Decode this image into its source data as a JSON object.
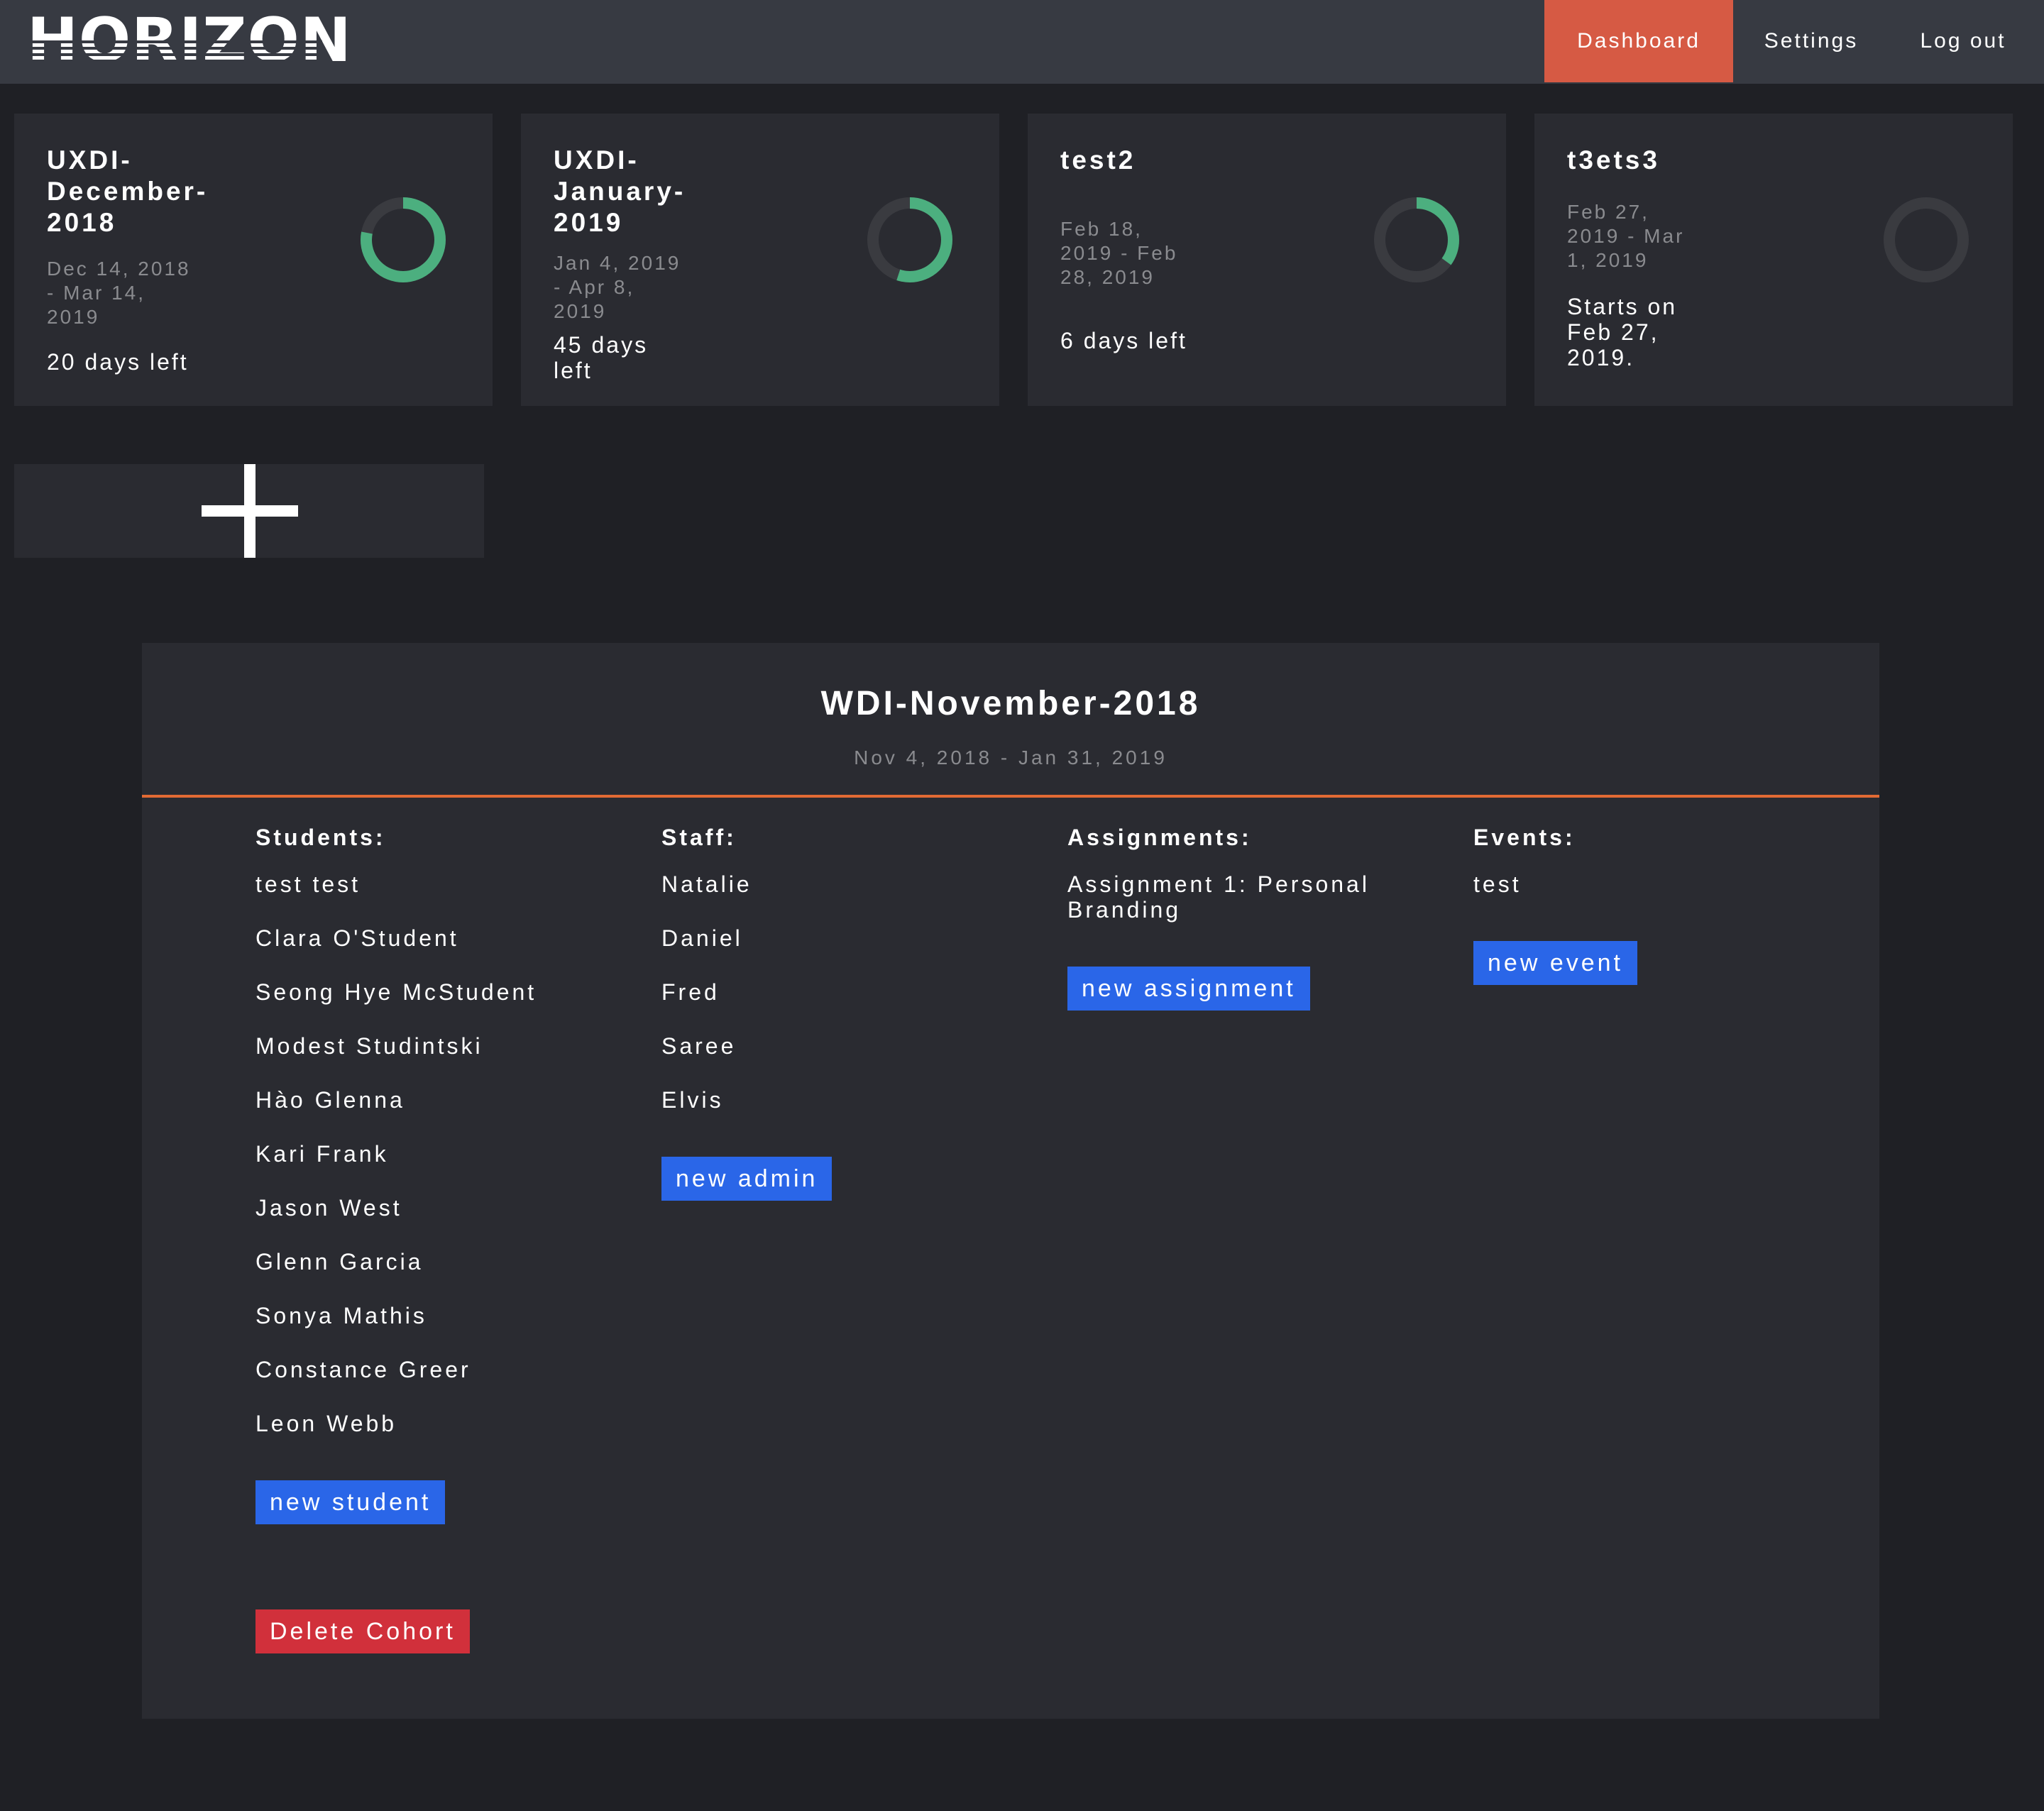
{
  "header": {
    "logo": "HORIZON",
    "nav": [
      {
        "label": "Dashboard",
        "active": true
      },
      {
        "label": "Settings",
        "active": false
      },
      {
        "label": "Log out",
        "active": false
      }
    ]
  },
  "colors": {
    "background": "#1f2025",
    "header": "#373a42",
    "card": "#2a2b31",
    "accent_nav": "#d65a44",
    "progress": "#4caf7f",
    "divider": "#e26a34",
    "button_primary": "#2a66e8",
    "button_danger": "#d1303b"
  },
  "cohorts": [
    {
      "name": "UXDI-\nDecember-\n2018",
      "dates": "Dec 14, 2018\n- Mar 14,\n2019",
      "status": "20 days left",
      "progress": 0.78
    },
    {
      "name": "UXDI-\nJanuary-\n2019",
      "dates": "Jan 4, 2019\n- Apr 8,\n2019",
      "status": "45 days\nleft",
      "progress": 0.55
    },
    {
      "name": "test2",
      "dates": "Feb 18,\n2019 - Feb\n28, 2019",
      "status": "6 days left",
      "progress": 0.35
    },
    {
      "name": "t3ets3",
      "dates": "Feb 27,\n2019 - Mar\n1, 2019",
      "status": "Starts on\nFeb 27,\n2019.",
      "progress": 0
    }
  ],
  "add_cohort_icon": "plus-icon",
  "selected_cohort": {
    "title": "WDI-November-2018",
    "dates": "Nov 4, 2018 - Jan 31, 2019",
    "students": {
      "heading": "Students:",
      "items": [
        "test test",
        "Clara O'Student",
        "Seong Hye McStudent",
        "Modest Studintski",
        "Hào Glenna",
        "Kari Frank",
        "Jason West",
        "Glenn Garcia",
        "Sonya Mathis",
        "Constance Greer",
        "Leon Webb"
      ],
      "button": "new student"
    },
    "staff": {
      "heading": "Staff:",
      "items": [
        "Natalie",
        "Daniel",
        "Fred",
        "Saree",
        "Elvis"
      ],
      "button": "new admin"
    },
    "assignments": {
      "heading": "Assignments:",
      "items": [
        "Assignment 1: Personal Branding"
      ],
      "button": "new assignment"
    },
    "events": {
      "heading": "Events:",
      "items": [
        "test"
      ],
      "button": "new event"
    },
    "delete_button": "Delete Cohort"
  }
}
